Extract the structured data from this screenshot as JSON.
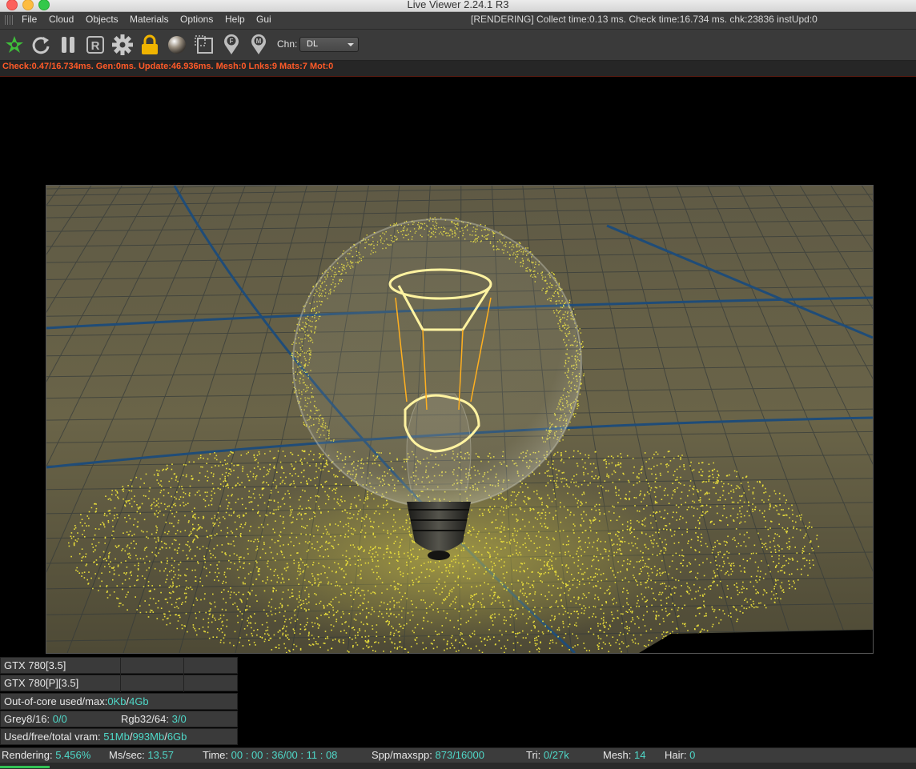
{
  "window": {
    "title": "Live Viewer 2.24.1 R3"
  },
  "menu": {
    "items": [
      "File",
      "Cloud",
      "Objects",
      "Materials",
      "Options",
      "Help",
      "Gui"
    ],
    "status_text": "[RENDERING] Collect time:0.13 ms.  Check time:16.734 ms.  chk:23836  instUpd:0"
  },
  "toolbar": {
    "icons": [
      "octane-logo-icon",
      "refresh-icon",
      "pause-icon",
      "r-icon",
      "gear-icon",
      "lock-icon",
      "material-sphere-icon",
      "region-render-icon",
      "focus-pin-icon",
      "material-pin-icon"
    ],
    "channel_label": "Chn:",
    "channel_value": "DL"
  },
  "stats_line": "Check:0.47/16.734ms. Gen:0ms. Update:46.936ms. Mesh:0 Lnks:9 Mats:7 Mot:0",
  "devices": {
    "gpu1": "GTX 780[3.5]",
    "gpu2": "GTX 780[P][3.5]",
    "out_of_core_label": "Out-of-core used/max:",
    "out_of_core_used": "0Kb",
    "out_of_core_sep": "/",
    "out_of_core_max": "4Gb",
    "grey_label": "Grey8/16:",
    "grey_value": "0/0",
    "rgb_label": "Rgb32/64:",
    "rgb_value": "3/0",
    "vram_label": "Used/free/total vram:",
    "vram_used": "51Mb",
    "vram_sep1": "/",
    "vram_free": "993Mb",
    "vram_sep2": "/",
    "vram_total": "6Gb"
  },
  "status_bar": {
    "rendering_label": "Rendering:",
    "rendering_value": "5.456%",
    "ms_label": "Ms/sec:",
    "ms_value": "13.57",
    "time_label": "Time:",
    "time_value": "00 : 00 : 36/00 : 11 : 08",
    "spp_label": "Spp/maxspp:",
    "spp_value": "873/16000",
    "tri_label": "Tri:",
    "tri_value": "0/27k",
    "mesh_label": "Mesh:",
    "mesh_value": "14",
    "hair_label": "Hair:",
    "hair_value": "0",
    "progress": 0.05456
  },
  "colors": {
    "accent_orange": "#ff5a28",
    "value_cyan": "#4fd8c8",
    "progress_green": "#33c255"
  }
}
